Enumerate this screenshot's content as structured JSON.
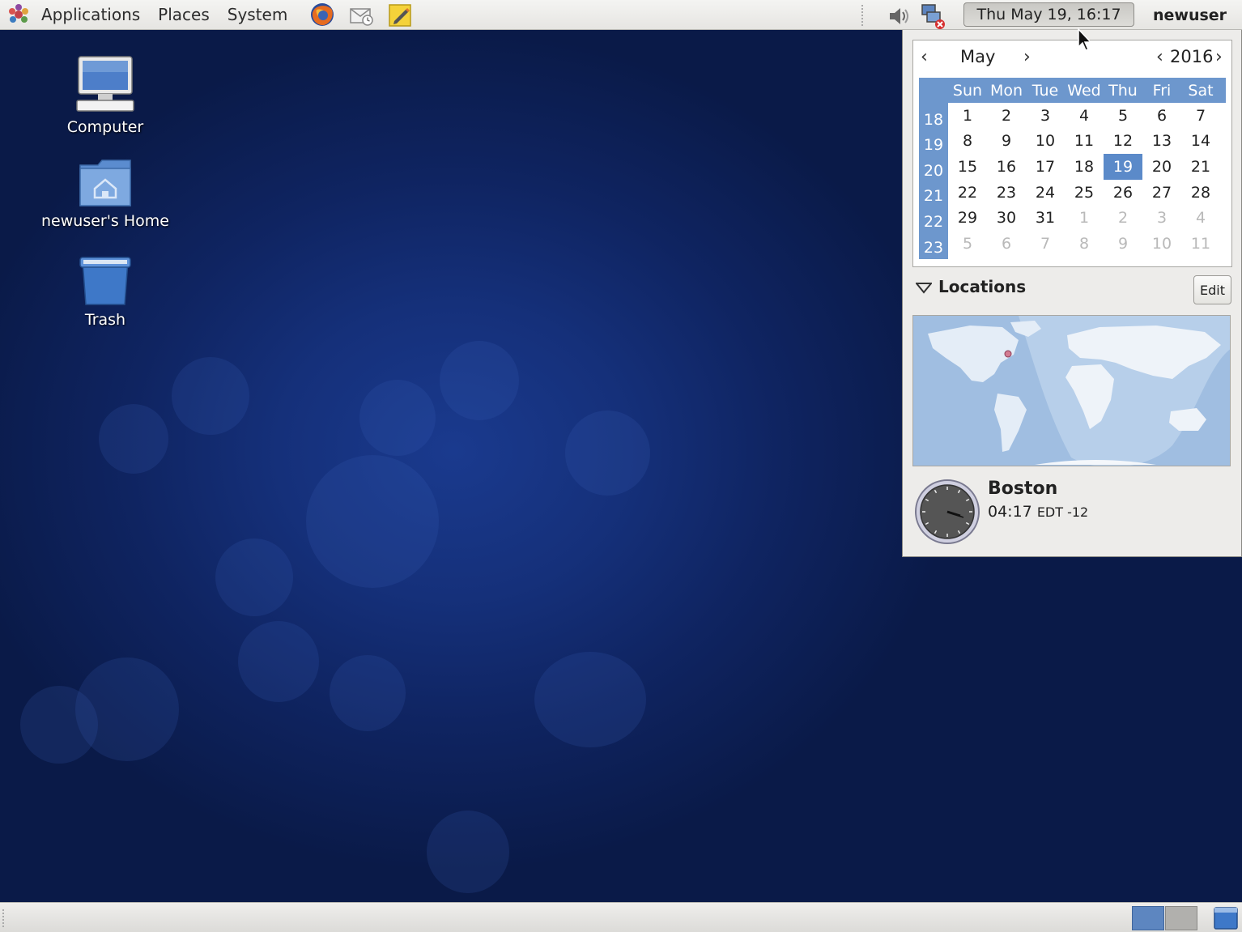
{
  "top_panel": {
    "menus": [
      "Applications",
      "Places",
      "System"
    ],
    "launchers": [
      "firefox-icon",
      "mail-icon",
      "notes-icon"
    ],
    "clock": "Thu May 19, 16:17",
    "user": "newuser"
  },
  "desktop": {
    "icons": [
      {
        "label": "Computer",
        "icon": "computer-icon"
      },
      {
        "label": "newuser's Home",
        "icon": "home-folder-icon"
      },
      {
        "label": "Trash",
        "icon": "trash-icon"
      }
    ]
  },
  "calendar": {
    "prev_month": "‹",
    "month": "May",
    "next_month": "›",
    "prev_year": "‹",
    "year": "2016",
    "next_year": "›",
    "weekdays": [
      "Sun",
      "Mon",
      "Tue",
      "Wed",
      "Thu",
      "Fri",
      "Sat"
    ],
    "week_numbers": [
      "18",
      "19",
      "20",
      "21",
      "22",
      "23"
    ],
    "weeks": [
      [
        "1",
        "2",
        "3",
        "4",
        "5",
        "6",
        "7"
      ],
      [
        "8",
        "9",
        "10",
        "11",
        "12",
        "13",
        "14"
      ],
      [
        "15",
        "16",
        "17",
        "18",
        "19",
        "20",
        "21"
      ],
      [
        "22",
        "23",
        "24",
        "25",
        "26",
        "27",
        "28"
      ],
      [
        "29",
        "30",
        "31",
        "1",
        "2",
        "3",
        "4"
      ],
      [
        "5",
        "6",
        "7",
        "8",
        "9",
        "10",
        "11"
      ]
    ],
    "today": "19",
    "accent": "#6d97cd"
  },
  "locations": {
    "title": "Locations",
    "edit_label": "Edit",
    "city": "Boston",
    "time": "04:17",
    "tz": "EDT -12"
  }
}
